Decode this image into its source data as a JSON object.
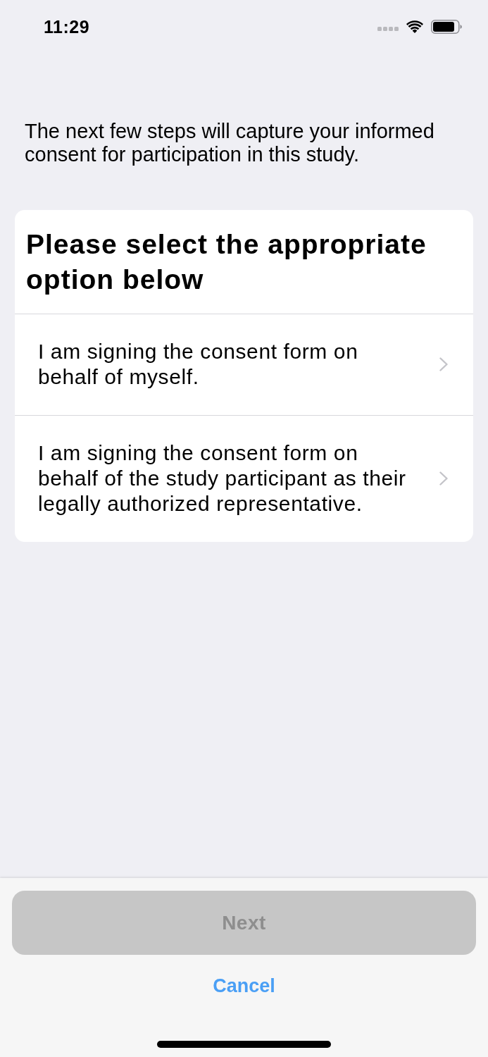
{
  "status_bar": {
    "time": "11:29"
  },
  "intro": "The next few steps will capture your informed consent for participation in this study.",
  "card": {
    "title": "Please select the appropriate option below",
    "options": [
      {
        "label": "I am signing the consent form on behalf of myself."
      },
      {
        "label": "I am signing the consent form on behalf of the study participant as their legally authorized representative."
      }
    ]
  },
  "footer": {
    "next": {
      "label": "Next",
      "disabled": true
    },
    "cancel": {
      "label": "Cancel"
    }
  }
}
